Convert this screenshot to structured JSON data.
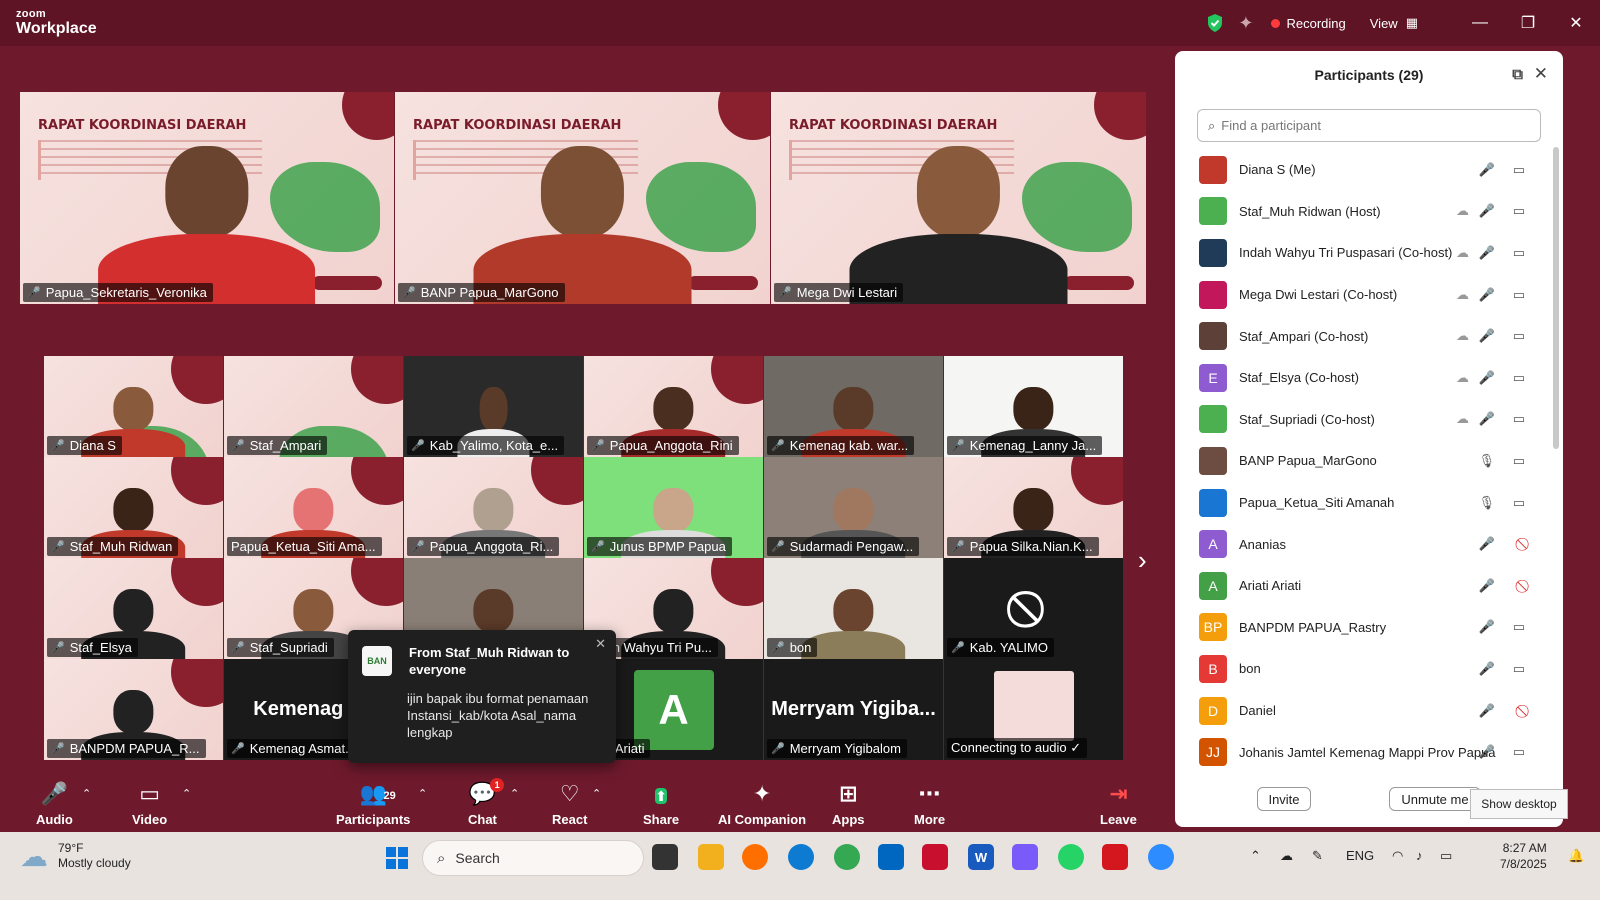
{
  "app": {
    "brand_small": "zoom",
    "brand_big": "Workplace"
  },
  "topbar": {
    "recording_label": "Recording",
    "view_label": "View"
  },
  "top_row": [
    {
      "name": "Papua_Sekretaris_Veronika"
    },
    {
      "name": "BANP Papua_MarGono",
      "active": true
    },
    {
      "name": "Mega Dwi Lestari"
    }
  ],
  "banner": {
    "title": "RAPAT KOORDINASI DAERAH"
  },
  "grid": [
    {
      "name": "Diana S"
    },
    {
      "name": "Staf_Ampari"
    },
    {
      "name": "Kab_Yalimo, Kota_e..."
    },
    {
      "name": "Papua_Anggota_Rini"
    },
    {
      "name": "Kemenag kab. war..."
    },
    {
      "name": "Kemenag_Lanny Ja..."
    },
    {
      "name": "Staf_Muh Ridwan"
    },
    {
      "name": "Papua_Ketua_Siti Ama..."
    },
    {
      "name": "Papua_Anggota_Ri..."
    },
    {
      "name": "Junus BPMP Papua"
    },
    {
      "name": "Sudarmadi Pengaw..."
    },
    {
      "name": "Papua Silka.Nian.K..."
    },
    {
      "name": "Staf_Elsya"
    },
    {
      "name": "Staf_Supriadi"
    },
    {
      "name": ""
    },
    {
      "name": "ndah Wahyu Tri Pu..."
    },
    {
      "name": "bon"
    },
    {
      "name": "Kab. YALIMO"
    },
    {
      "name": "BANPDM PAPUA_R..."
    },
    {
      "name": "Kemenag Asmat...",
      "display": "Kemenag As"
    },
    {
      "name": ""
    },
    {
      "name": "riati Ariati",
      "avatar": "A"
    },
    {
      "name": "Merryam Yigibalom",
      "display": "Merryam Yigiba..."
    },
    {
      "name": "Connecting to audio ✓"
    }
  ],
  "toast": {
    "from": "From Staf_Muh Ridwan to everyone",
    "message": "ijin bapak ibu format penamaan Instansi_kab/kota Asal_nama lengkap"
  },
  "toolbar": {
    "audio": "Audio",
    "video": "Video",
    "participants": "Participants",
    "participants_count": "29",
    "chat": "Chat",
    "chat_badge": "1",
    "react": "React",
    "share": "Share",
    "ai": "AI Companion",
    "apps": "Apps",
    "more": "More",
    "leave": "Leave"
  },
  "panel": {
    "title": "Participants (29)",
    "search_placeholder": "Find a participant",
    "invite": "Invite",
    "unmute_me": "Unmute me",
    "participants": [
      {
        "name": "Diana S (Me)",
        "avatar": "",
        "color": "#c0392b",
        "mic": "muted",
        "video": "on",
        "cloud": false
      },
      {
        "name": "Staf_Muh Ridwan (Host)",
        "avatar": "",
        "color": "#4caf50",
        "mic": "muted",
        "video": "on",
        "cloud": true
      },
      {
        "name": "Indah Wahyu Tri Puspasari (Co-host)",
        "avatar": "",
        "color": "#1f3b57",
        "mic": "muted",
        "video": "on",
        "cloud": true
      },
      {
        "name": "Mega Dwi Lestari (Co-host)",
        "avatar": "",
        "color": "#c2185b",
        "mic": "muted",
        "video": "on",
        "cloud": true
      },
      {
        "name": "Staf_Ampari (Co-host)",
        "avatar": "",
        "color": "#5d4037",
        "mic": "muted",
        "video": "on",
        "cloud": true
      },
      {
        "name": "Staf_Elsya (Co-host)",
        "avatar": "E",
        "color": "#8e5bd0",
        "mic": "muted",
        "video": "on",
        "cloud": true
      },
      {
        "name": "Staf_Supriadi (Co-host)",
        "avatar": "",
        "color": "#4caf50",
        "mic": "muted",
        "video": "on",
        "cloud": true
      },
      {
        "name": "BANP Papua_MarGono",
        "avatar": "",
        "color": "#6d4c41",
        "mic": "on",
        "video": "on",
        "cloud": false
      },
      {
        "name": "Papua_Ketua_Siti Amanah",
        "avatar": "",
        "color": "#1976d2",
        "mic": "on",
        "video": "on",
        "cloud": false
      },
      {
        "name": "Ananias",
        "avatar": "A",
        "color": "#8e5bd0",
        "mic": "muted",
        "video": "off",
        "cloud": false
      },
      {
        "name": "Ariati Ariati",
        "avatar": "A",
        "color": "#43a047",
        "mic": "muted",
        "video": "off",
        "cloud": false
      },
      {
        "name": "BANPDM PAPUA_Rastry",
        "avatar": "BP",
        "color": "#f59e0b",
        "mic": "muted",
        "video": "on",
        "cloud": false
      },
      {
        "name": "bon",
        "avatar": "B",
        "color": "#e53935",
        "mic": "muted",
        "video": "on",
        "cloud": false
      },
      {
        "name": "Daniel",
        "avatar": "D",
        "color": "#f59e0b",
        "mic": "muted",
        "video": "off",
        "cloud": false
      },
      {
        "name": "Johanis Jamtel Kemenag Mappi Prov Papua",
        "avatar": "JJ",
        "color": "#d35400",
        "mic": "muted",
        "video": "on",
        "cloud": false
      }
    ]
  },
  "tooltip": "Show desktop",
  "taskbar": {
    "temperature": "79°F",
    "weather": "Mostly cloudy",
    "search": "Search",
    "lang": "ENG",
    "time": "8:27 AM",
    "date": "7/8/2025"
  }
}
